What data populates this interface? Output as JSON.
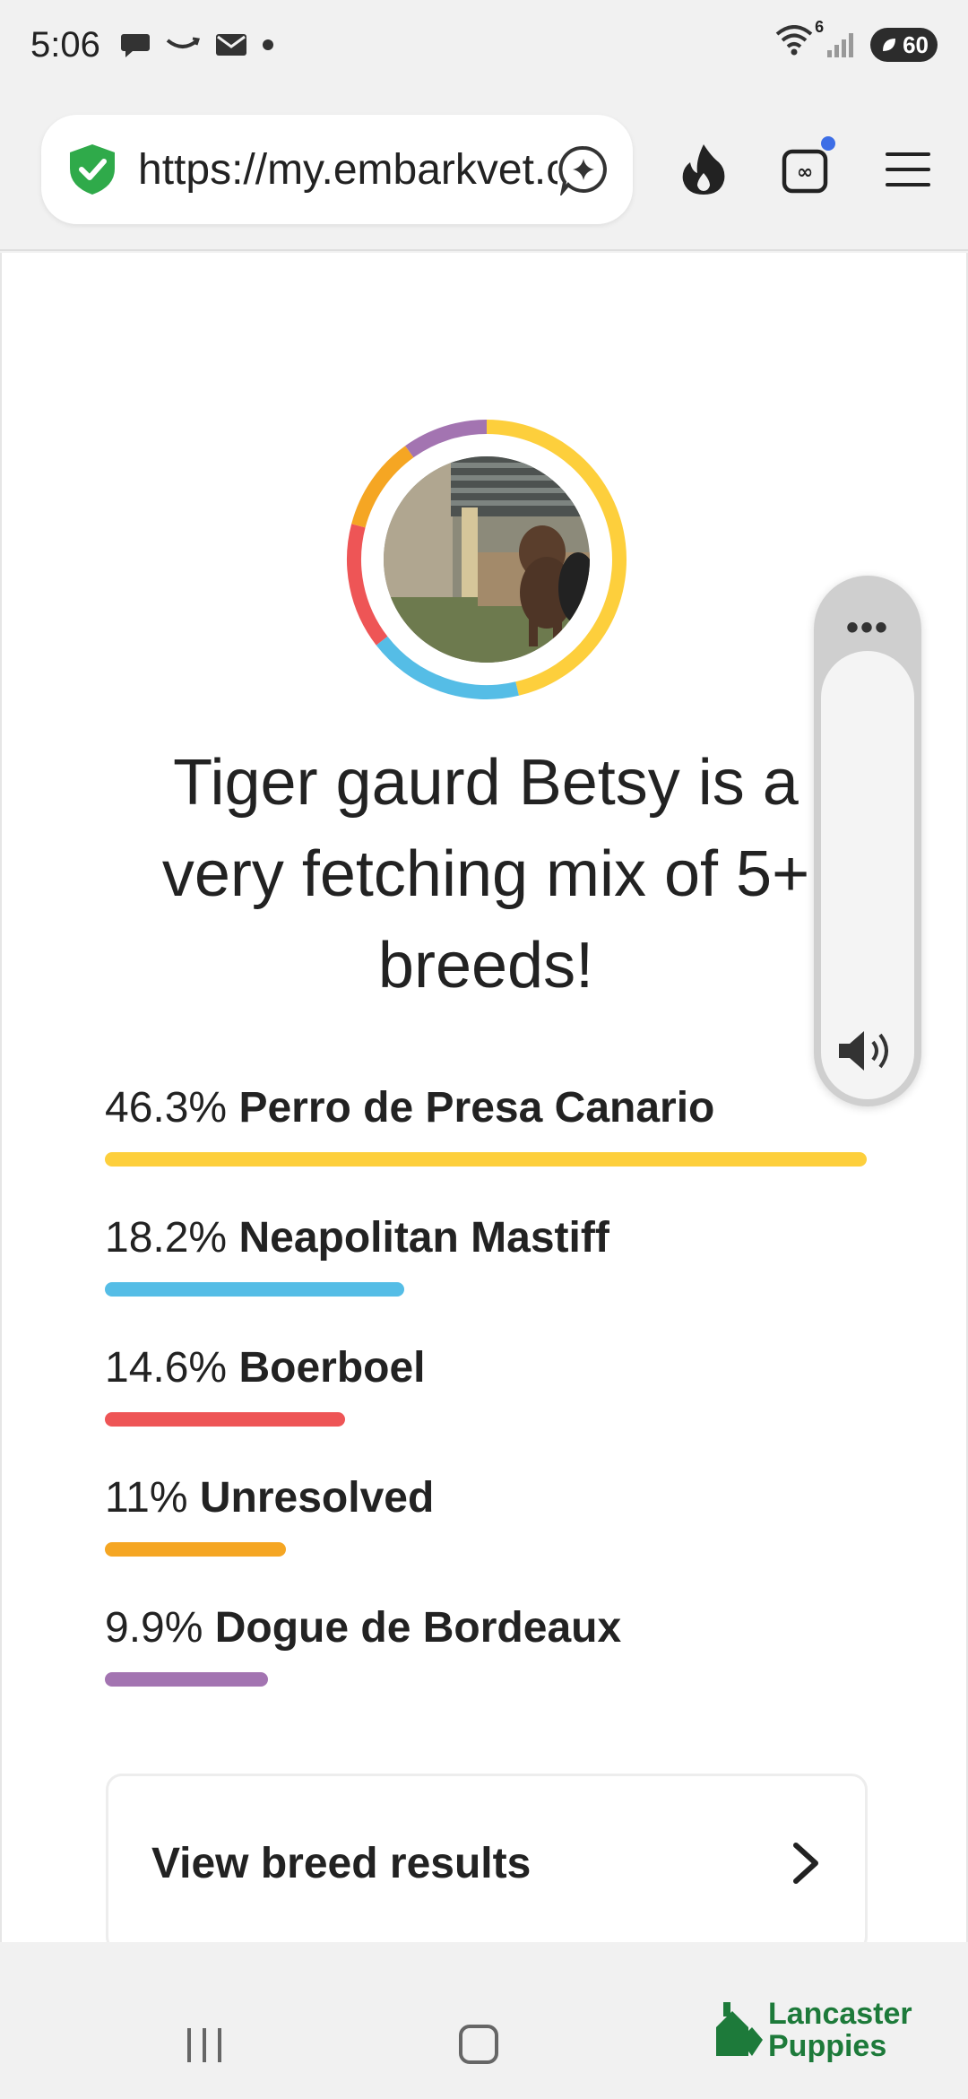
{
  "status_bar": {
    "time": "5:06",
    "wifi_superscript": "6",
    "battery_level": "60",
    "icons": [
      "chat-bubble-icon",
      "amazon-smile-icon",
      "mail-icon",
      "dot-icon",
      "wifi-icon",
      "signal-icon",
      "battery-icon"
    ]
  },
  "browser": {
    "url": "https://my.embarkvet.com",
    "icons": [
      "shield-check-icon",
      "sparkle-chat-icon",
      "flame-icon",
      "tabs-counter-icon",
      "hamburger-menu-icon"
    ]
  },
  "profile": {
    "ring_colors": [
      "#fdcf3c",
      "#55bde6",
      "#ee5556",
      "#f5a623",
      "#a374b1"
    ]
  },
  "headline": {
    "line1": "Tiger gaurd Betsy is a",
    "line2": "very fetching mix of 5+",
    "line3": "breeds!"
  },
  "breeds": [
    {
      "pct": "46.3%",
      "name": "Perro de Presa Canario",
      "value": 46.3,
      "color": "#fdcf3c"
    },
    {
      "pct": "18.2%",
      "name": "Neapolitan Mastiff",
      "value": 18.2,
      "color": "#55bde6"
    },
    {
      "pct": "14.6%",
      "name": "Boerboel",
      "value": 14.6,
      "color": "#ee5556"
    },
    {
      "pct": "11%",
      "name": "Unresolved",
      "value": 11,
      "color": "#f5a623"
    },
    {
      "pct": "9.9%",
      "name": "Dogue de Bordeaux",
      "value": 9.9,
      "color": "#a374b1"
    }
  ],
  "view_results": {
    "label": "View breed results"
  },
  "volume_panel": {
    "more_label": "•••"
  },
  "watermark": {
    "line1": "Lancaster",
    "line2": "Puppies"
  }
}
